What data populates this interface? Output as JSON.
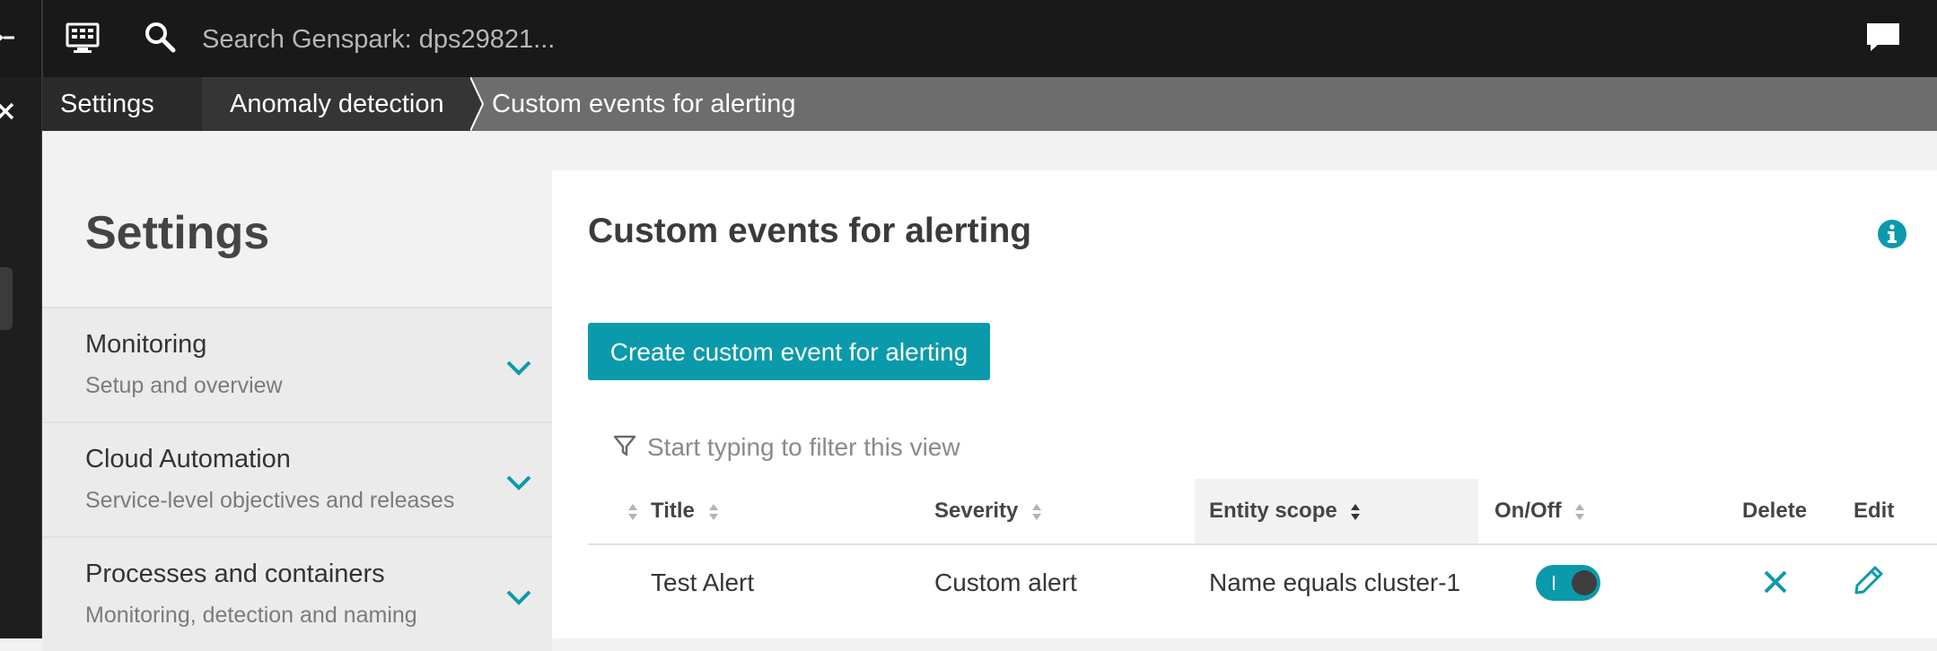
{
  "topbar": {
    "search_placeholder": "Search Genspark: dps29821..."
  },
  "breadcrumb": {
    "items": [
      "Settings",
      "Anomaly detection",
      "Custom events for alerting"
    ]
  },
  "sidebar": {
    "heading": "Settings",
    "sections": [
      {
        "title": "Monitoring",
        "subtitle": "Setup and overview"
      },
      {
        "title": "Cloud Automation",
        "subtitle": "Service-level objectives and releases"
      },
      {
        "title": "Processes and containers",
        "subtitle": "Monitoring, detection and naming"
      }
    ]
  },
  "main": {
    "title": "Custom events for alerting",
    "create_button": "Create custom event for alerting",
    "filter_placeholder": "Start typing to filter this view",
    "columns": [
      "Title",
      "Severity",
      "Entity scope",
      "On/Off",
      "Delete",
      "Edit"
    ],
    "sorted_column": "Entity scope",
    "rows": [
      {
        "title": "Test Alert",
        "severity": "Custom alert",
        "entity_scope": "Name equals cluster-1",
        "enabled": true
      }
    ]
  },
  "colors": {
    "accent": "#0b9aab",
    "topbar": "#191919",
    "breadcrumb": "#6d6d6d"
  },
  "icons": [
    "collapse-icon",
    "close-icon",
    "monitor-icon",
    "search-icon",
    "chat-icon",
    "chevron-down-icon",
    "info-icon",
    "filter-icon",
    "sort-icon",
    "delete-icon",
    "edit-icon"
  ]
}
